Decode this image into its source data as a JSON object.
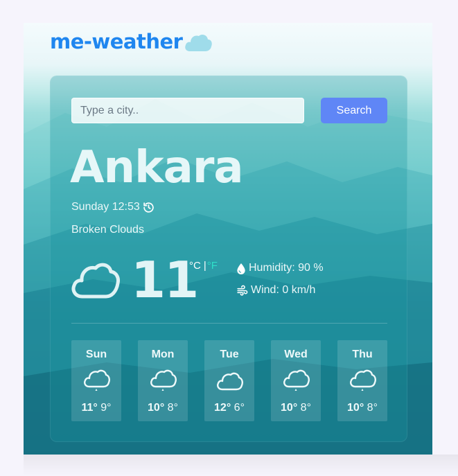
{
  "brand": {
    "name": "me-weather"
  },
  "search": {
    "placeholder": "Type a city..",
    "button_label": "Search"
  },
  "current": {
    "city": "Ankara",
    "datetime": "Sunday 12:53",
    "description": "Broken Clouds",
    "temperature": "11",
    "unit_c": "°C",
    "unit_separator": "|",
    "unit_f": "°F",
    "humidity_label": "Humidity: 90 %",
    "wind_label": "Wind: 0 km/h",
    "icon": "cloud-icon"
  },
  "forecast": [
    {
      "day": "Sun",
      "max": "11°",
      "min": "9°",
      "icon": "cloud-rain-icon"
    },
    {
      "day": "Mon",
      "max": "10°",
      "min": "8°",
      "icon": "cloud-rain-icon"
    },
    {
      "day": "Tue",
      "max": "12°",
      "min": "6°",
      "icon": "cloud-icon"
    },
    {
      "day": "Wed",
      "max": "10°",
      "min": "8°",
      "icon": "cloud-rain-icon"
    },
    {
      "day": "Thu",
      "max": "10°",
      "min": "8°",
      "icon": "cloud-rain-icon"
    }
  ],
  "colors": {
    "brand": "#1f86ef",
    "search_button": "#5f86f6",
    "unit_active": "#2fe0c9"
  }
}
